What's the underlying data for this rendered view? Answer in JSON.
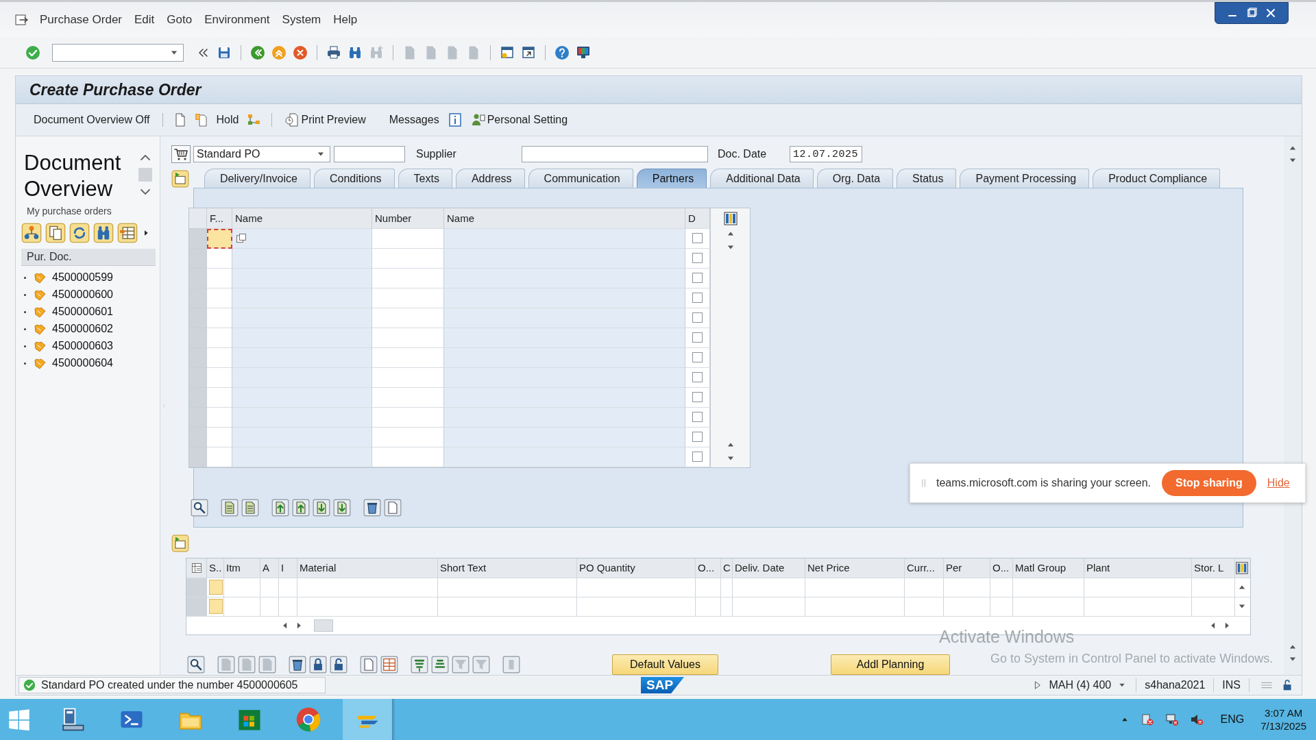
{
  "menu": [
    "Purchase Order",
    "Edit",
    "Goto",
    "Environment",
    "System",
    "Help"
  ],
  "toolbar_icons": [
    {
      "disabled": false
    },
    {
      "disabled": false
    },
    {
      "disabled": false
    },
    {
      "disabled": false
    },
    {
      "disabled": false
    },
    {
      "disabled": false
    },
    {
      "disabled": false
    },
    {
      "disabled": false
    },
    {
      "disabled": true
    },
    {
      "disabled": true
    },
    {
      "disabled": true
    },
    {
      "disabled": true
    },
    {
      "disabled": true
    },
    {
      "disabled": false
    },
    {
      "disabled": false
    },
    {
      "disabled": false
    },
    {
      "disabled": false
    }
  ],
  "title": "Create Purchase Order",
  "app_toolbar": [
    {
      "kind": "text",
      "label": "Document Overview Off"
    },
    {
      "kind": "separator"
    },
    {
      "kind": "icon"
    },
    {
      "kind": "icon"
    },
    {
      "kind": "text",
      "label": "Hold"
    },
    {
      "kind": "icon"
    },
    {
      "kind": "separator"
    },
    {
      "kind": "icon_text",
      "label": "Print Preview"
    },
    {
      "kind": "text",
      "label": "Messages"
    },
    {
      "kind": "icon"
    },
    {
      "kind": "icon_text",
      "label": "Personal Setting"
    }
  ],
  "overview": {
    "title": "Document Overview",
    "subtitle": "My purchase orders",
    "column": "Pur. Doc.",
    "items": [
      "4500000599",
      "4500000600",
      "4500000601",
      "4500000602",
      "4500000603",
      "4500000604"
    ]
  },
  "header": {
    "doc_type": "Standard PO",
    "supplier_label": "Supplier",
    "date_label": "Doc. Date",
    "date": "12.07.2025"
  },
  "tabs": [
    {
      "label": "Delivery/Invoice",
      "selected": false
    },
    {
      "label": "Conditions",
      "selected": false
    },
    {
      "label": "Texts",
      "selected": false
    },
    {
      "label": "Address",
      "selected": false
    },
    {
      "label": "Communication",
      "selected": false
    },
    {
      "label": "Partners",
      "selected": true
    },
    {
      "label": "Additional Data",
      "selected": false
    },
    {
      "label": "Org. Data",
      "selected": false
    },
    {
      "label": "Status",
      "selected": false
    },
    {
      "label": "Payment Processing",
      "selected": false
    },
    {
      "label": "Product Compliance",
      "selected": false
    }
  ],
  "partners": {
    "columns": [
      "F...",
      "Name",
      "Number",
      "Name",
      "D"
    ],
    "rows": [
      {
        "focused": true,
        "checked": false
      },
      {
        "focused": false,
        "checked": false
      },
      {
        "focused": false,
        "checked": false
      },
      {
        "focused": false,
        "checked": false
      },
      {
        "focused": false,
        "checked": false
      },
      {
        "focused": false,
        "checked": false
      },
      {
        "focused": false,
        "checked": false
      },
      {
        "focused": false,
        "checked": false
      },
      {
        "focused": false,
        "checked": false
      },
      {
        "focused": false,
        "checked": false
      },
      {
        "focused": false,
        "checked": false
      },
      {
        "focused": false,
        "checked": false
      }
    ]
  },
  "grid_toolbar": [
    {
      "disabled": false
    },
    {
      "disabled": false
    },
    {
      "disabled": false
    },
    {
      "disabled": false
    },
    {
      "disabled": false
    },
    {
      "disabled": false
    },
    {
      "disabled": false
    },
    {
      "disabled": false
    },
    {
      "disabled": false
    }
  ],
  "items": {
    "columns": [
      "S..",
      "Itm",
      "A",
      "I",
      "Material",
      "Short Text",
      "PO Quantity",
      "O...",
      "C",
      "Deliv. Date",
      "Net Price",
      "Curr...",
      "Per",
      "O...",
      "Matl Group",
      "Plant",
      "Stor. L"
    ],
    "rows": [
      {
        "kind": "empty"
      },
      {
        "kind": "empty"
      }
    ]
  },
  "items_toolbar": [
    {
      "disabled": false
    },
    {
      "disabled": true
    },
    {
      "disabled": true
    },
    {
      "disabled": true
    },
    {
      "disabled": false
    },
    {
      "disabled": false
    },
    {
      "disabled": false
    },
    {
      "disabled": false
    },
    {
      "disabled": false
    },
    {
      "disabled": false
    },
    {
      "disabled": false
    },
    {
      "disabled": true
    },
    {
      "disabled": true
    },
    {
      "disabled": true
    }
  ],
  "buttons": [
    "Default Values",
    "Addl Planning"
  ],
  "status": {
    "success": true,
    "message": "Standard PO created under the number 4500000605",
    "logo": "SAP",
    "system": "MAH (4) 400",
    "server": "s4hana2021",
    "mode": "INS"
  },
  "taskbar": {
    "language": "ENG",
    "time": "3:07 AM",
    "date": "7/13/2025"
  },
  "share_bar": {
    "message": "teams.microsoft.com is sharing your screen.",
    "stop": "Stop sharing",
    "hide": "Hide"
  },
  "activation": {
    "title": "Activate Windows",
    "message": "Go to System in Control Panel to activate Windows."
  }
}
